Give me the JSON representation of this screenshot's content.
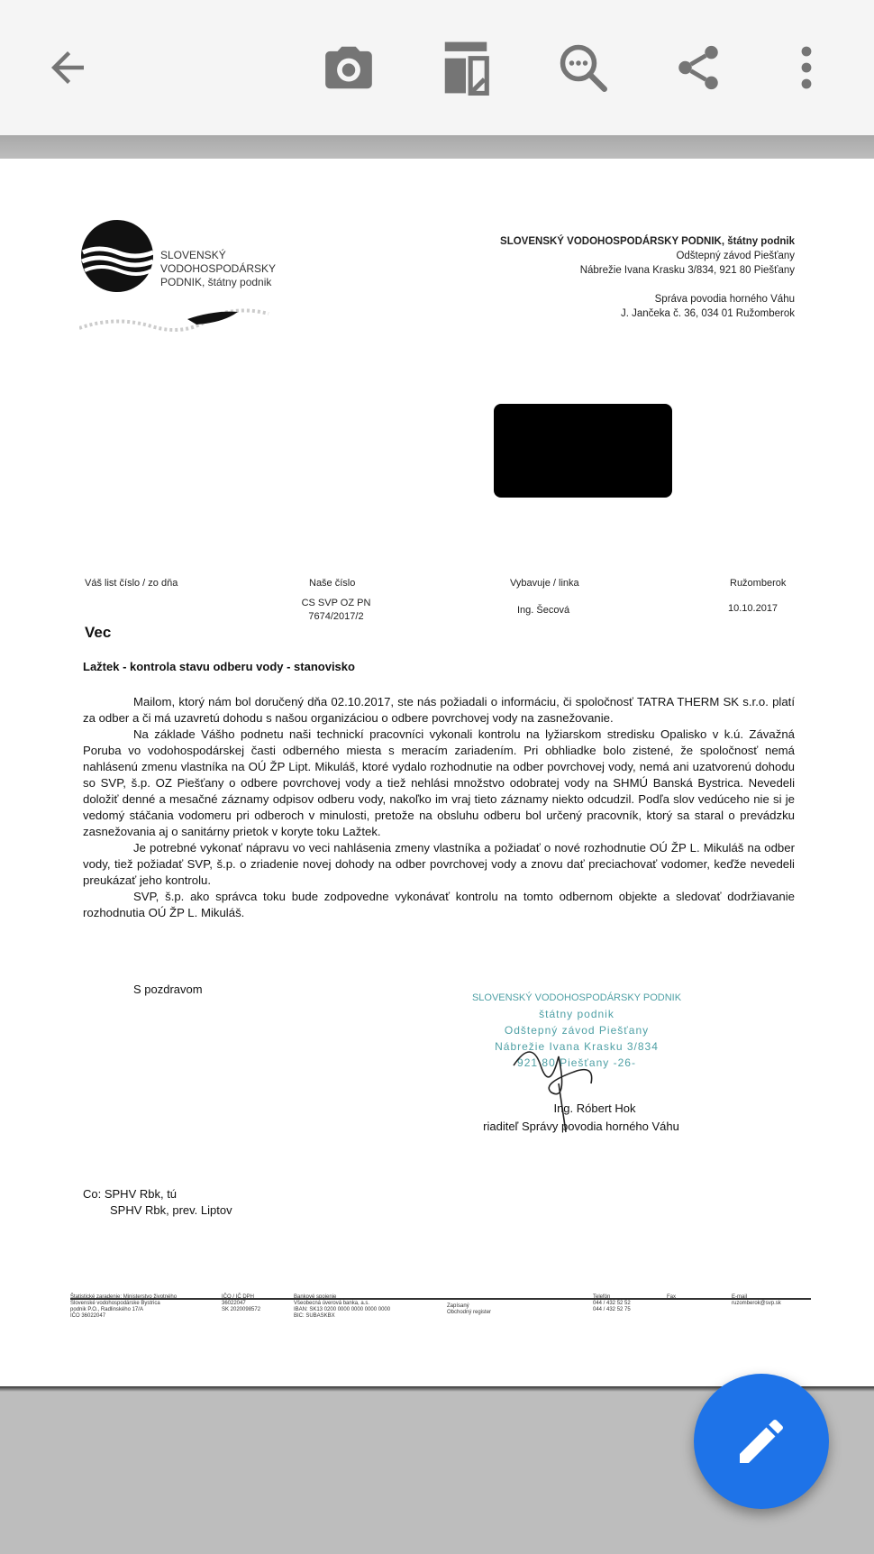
{
  "toolbar": {
    "back_icon": "arrow-left-icon",
    "camera_icon": "camera-icon",
    "crop_icon": "crop-icon",
    "search_icon": "search-more-icon",
    "share_icon": "share-icon",
    "more_icon": "more-vert-icon"
  },
  "fab": {
    "icon": "pencil-icon",
    "color": "#1e73e8"
  },
  "document": {
    "logo_text": [
      "SLOVENSKÝ",
      "VODOHOSPODÁRSKY",
      "PODNIK, štátny podnik"
    ],
    "org_lines": [
      "SLOVENSKÝ VODOHOSPODÁRSKY PODNIK, štátny podnik",
      "Odštepný závod Piešťany",
      "Nábrežie Ivana Krasku 3/834, 921 80 Piešťany",
      "Správa povodia horného Váhu",
      "J. Jančeka č. 36, 034 01 Ružomberok"
    ],
    "ref_headers": [
      "Váš list číslo / zo dňa",
      "Naše číslo",
      "Vybavuje / linka",
      "Ružomberok"
    ],
    "ref_values": [
      "CS SVP OZ PN",
      "7674/2017/2",
      "Ing. Šecová",
      "10.10.2017"
    ],
    "subject_heading": "Vec",
    "subject": "Lažtek - kontrola stavu odberu vody - stanovisko",
    "paragraphs": [
      "Mailom, ktorý nám bol doručený dňa 02.10.2017, ste nás požiadali o informáciu, či spoločnosť TATRA THERM SK s.r.o. platí za odber a či má uzavretú dohodu s našou organizáciou o odbere povrchovej vody na zasnežovanie.",
      "Na základe Vášho podnetu naši technickí pracovníci vykonali kontrolu na lyžiarskom stredisku Opalisko v k.ú. Závažná Poruba vo vodohospodárskej časti odberného miesta s meracím zariadením. Pri obhliadke bolo zistené, že spoločnosť nemá nahlásenú zmenu vlastníka na OÚ ŽP Lipt. Mikuláš, ktoré vydalo rozhodnutie na odber povrchovej vody, nemá ani uzatvorenú dohodu so SVP, š.p. OZ Piešťany o odbere povrchovej vody a tiež nehlási množstvo odobratej vody na SHMÚ Banská Bystrica. Nevedeli doložiť denné a mesačné záznamy odpisov odberu vody, nakoľko im vraj tieto záznamy niekto odcudzil. Podľa slov vedúceho nie si je vedomý stáčania vodomeru pri odberoch v minulosti, pretože na obsluhu odberu bol určený pracovník, ktorý sa staral o prevádzku zasnežovania aj o sanitárny prietok v koryte toku Lažtek.",
      "Je potrebné vykonať nápravu vo veci nahlásenia zmeny vlastníka a požiadať o nové rozhodnutie OÚ ŽP L. Mikuláš na odber vody, tiež požiadať SVP, š.p. o zriadenie novej dohody na odber povrchovej vody a znovu dať preciachovať vodomer, keďže nevedeli preukázať jeho kontrolu.",
      "SVP, š.p. ako správca toku bude zodpovedne vykonávať kontrolu na tomto odbernom objekte a sledovať dodržiavanie rozhodnutia OÚ ŽP L. Mikuláš."
    ],
    "closing": "S pozdravom",
    "stamp_lines": [
      "SLOVENSKÝ VODOHOSPODÁRSKY PODNIK",
      "štátny podnik",
      "Odštepný závod Piešťany",
      "Nábrežie Ivana Krasku 3/834",
      "921 80 Piešťany      -26-"
    ],
    "signer_name": "Ing. Róbert Hok",
    "signer_title": "riaditeľ Správy povodia horného Váhu",
    "cc_lines": [
      "Co: SPHV Rbk, tú",
      "SPHV Rbk, prev. Liptov"
    ],
    "footer_cols": [
      [
        "Štatistické zaradenie: Ministerstvo životného",
        "Slovenské vodohospodárske Bystrica",
        "podnik P.O., Radlinského 17/A",
        "IČO 36022047"
      ],
      [
        "IČO / IČ DPH",
        "36022047",
        "SK 2020098572"
      ],
      [
        "Bankové spojenie",
        "Všeobecná úverová banka, a.s.",
        "IBAN: SK13 0200 0000 0000 0000 0000",
        "BIC: SUBASKBX"
      ],
      [
        "Zapísaný",
        "Obchodný register"
      ],
      [
        "Telefón",
        "044 / 432 52 52",
        "044 / 432 52 75"
      ],
      [
        "Fax"
      ],
      [
        "E-mail",
        "ruzomberok@svp.sk"
      ]
    ]
  }
}
